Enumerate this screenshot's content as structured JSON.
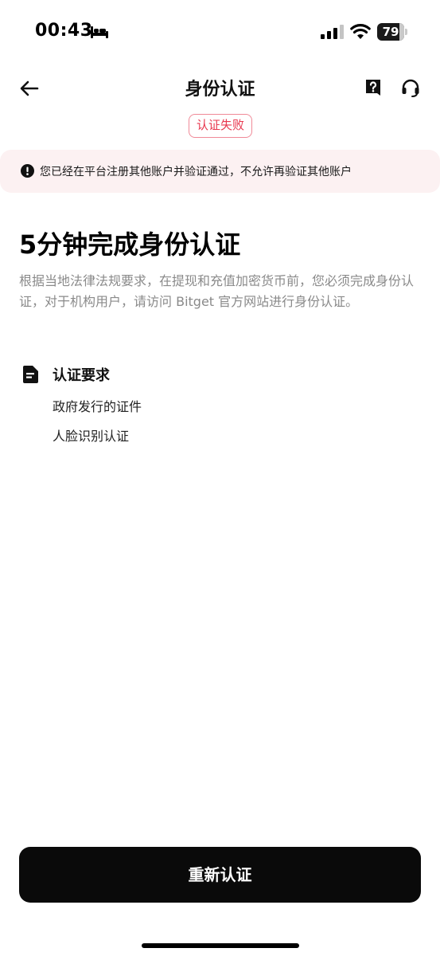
{
  "status_bar": {
    "time": "00:43",
    "battery_level": "79",
    "icons": [
      "bed-icon",
      "cellular-signal-icon",
      "wifi-icon",
      "battery-icon"
    ]
  },
  "nav": {
    "title": "身份认证",
    "back_icon": "arrow-left-icon",
    "help_icon": "question-mark-icon",
    "support_icon": "headset-icon"
  },
  "status_badge": "认证失败",
  "alert": {
    "icon": "exclamation-circle-icon",
    "message": "您已经在平台注册其他账户并验证通过，不允许再验证其他账户"
  },
  "main": {
    "heading": "5分钟完成身份认证",
    "description": "根据当地法律法规要求，在提现和充值加密货币前，您必须完成身份认证，对于机构用户，请访问 Bitget 官方网站进行身份认证。"
  },
  "requirements": {
    "icon": "document-icon",
    "title": "认证要求",
    "items": [
      "政府发行的证件",
      "人脸识别认证"
    ]
  },
  "action": {
    "button_label": "重新认证"
  },
  "colors": {
    "badge_red": "#e8384f",
    "alert_bg": "#fcf1f2",
    "button_bg": "#0a0a0a"
  }
}
